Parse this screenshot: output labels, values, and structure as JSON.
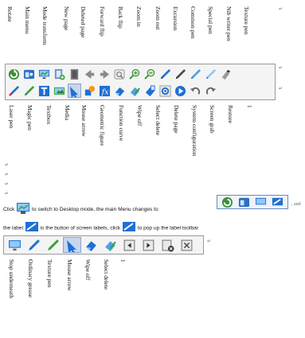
{
  "top_labels": [
    {
      "text": "Rotate"
    },
    {
      "text": "Main menu"
    },
    {
      "text": "Mode transform"
    },
    {
      "text": "New page"
    },
    {
      "text": "Deleted page"
    },
    {
      "text": "Forward flip"
    },
    {
      "text": "Back flip"
    },
    {
      "text": "Zoom in"
    },
    {
      "text": "Zoom out"
    },
    {
      "text": "Excursion"
    },
    {
      "text": "Common pen"
    },
    {
      "text": "Special pen"
    },
    {
      "text": "Nib writer pen"
    },
    {
      "text": "Texture pen"
    }
  ],
  "toolbar": {
    "row1_icons": [
      "rotate-icon",
      "main-menu-icon",
      "mode-transform-icon",
      "new-page-icon",
      "deleted-page-icon",
      "forward-flip-icon",
      "back-flip-icon",
      "zoom-in-icon",
      "zoom-out-icon",
      "excursion-icon",
      "common-pen-icon",
      "special-pen-icon",
      "nib-writer-pen-icon",
      "texture-pen-icon",
      "laser-pointer-icon"
    ],
    "row2_icons": [
      "laser-pen-icon",
      "magic-pen-icon",
      "textbox-icon",
      "media-icon",
      "mouse-arrow-icon",
      "geometric-figure-icon",
      "function-curve-icon",
      "wipe-off-icon",
      "select-delete-icon",
      "delete-page-icon",
      "system-configuration-icon",
      "screen-grab-icon",
      "restore-icon",
      "undo-icon"
    ]
  },
  "bottom_labels": [
    {
      "text": "Laser pen"
    },
    {
      "text": "Magic pen"
    },
    {
      "text": "Textbox"
    },
    {
      "text": "Media"
    },
    {
      "text": "Mouse arrow"
    },
    {
      "text": "Geometric figure"
    },
    {
      "text": "Function curve"
    },
    {
      "text": "Wipe off"
    },
    {
      "text": "Select delete"
    },
    {
      "text": "Delete page"
    },
    {
      "text": "System configuration"
    },
    {
      "text": "Screen grab"
    },
    {
      "text": "Restore"
    },
    {
      "text": "1"
    }
  ],
  "paragraph": {
    "part1": "Click",
    "part2": "to switch to Desktop mode, the main Menu changes to",
    "part3": ", and",
    "part4": "the label",
    "part5": "is the button of screen labels, click",
    "part6": "to pop up the label toolbar"
  },
  "label_toolbar_icons": [
    "desktop-icon",
    "ordinary-pen-icon",
    "texture-pen-icon",
    "mouse-arrow-icon",
    "wipe-off-icon",
    "select-delete-icon",
    "page-prev-icon",
    "page-next-icon",
    "page-delete-icon",
    "exit-icon"
  ],
  "label_toolbar_labels": [
    {
      "text": "Stop underneath"
    },
    {
      "text": "Ordinary grease"
    },
    {
      "text": "Texture pen"
    },
    {
      "text": "Mouse arrow"
    },
    {
      "text": "Wipe off"
    },
    {
      "text": "Select delete"
    },
    {
      "text": "1"
    }
  ],
  "colors": {
    "accent_blue": "#1f6fd6",
    "green": "#3aa03a",
    "toolbar_bg": "#f4f4f4",
    "border": "#9a9a9a"
  }
}
